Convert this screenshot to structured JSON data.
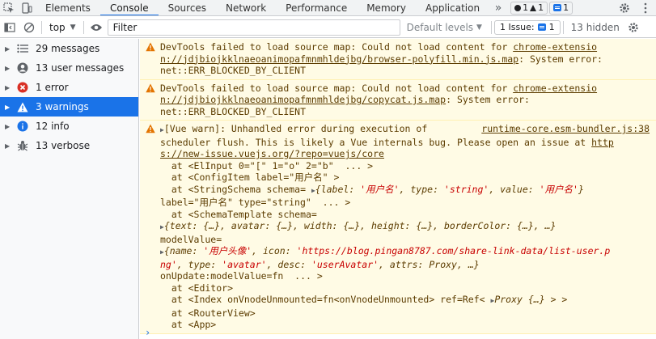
{
  "tabs": {
    "items": [
      "Elements",
      "Console",
      "Sources",
      "Network",
      "Performance",
      "Memory",
      "Application"
    ],
    "more": "»",
    "errors_count": "1",
    "warnings_count": "1",
    "messages_count": "1"
  },
  "toolbar": {
    "context": "top",
    "filter_placeholder": "Filter",
    "levels": "Default levels",
    "issues": "1 Issue:",
    "issues_count": "1",
    "hidden": "13 hidden"
  },
  "sidebar": {
    "items": [
      {
        "label": "29 messages",
        "icon": "list-icon"
      },
      {
        "label": "13 user messages",
        "icon": "user-icon"
      },
      {
        "label": "1 error",
        "icon": "error-icon"
      },
      {
        "label": "3 warnings",
        "icon": "warning-icon"
      },
      {
        "label": "12 info",
        "icon": "info-icon"
      },
      {
        "label": "13 verbose",
        "icon": "bug-icon"
      }
    ],
    "selected_index": 3
  },
  "console": {
    "warn1": {
      "l1_text": "DevTools failed to load source map: Could not load content for ",
      "l1_link": "chrome-extensio",
      "l2_link": "n://jdjbiojkklnaeoanimopafmnmhldejbg/browser-polyfill.min.js.map",
      "l2_text": ": System error:",
      "l3_text": "net::ERR_BLOCKED_BY_CLIENT"
    },
    "warn2": {
      "l1_text": "DevTools failed to load source map: Could not load content for ",
      "l1_link": "chrome-extensio",
      "l2_link": "n://jdjbiojkklnaeoanimopafmnmhldejbg/copycat.js.map",
      "l2_text": ": System error:",
      "l3_text": "net::ERR_BLOCKED_BY_CLIENT"
    },
    "warn3": {
      "source": "runtime-core.esm-bundler.js:38",
      "l1": "[Vue warn]: Unhandled error during execution of",
      "l2a": "scheduler flush. This is likely a Vue internals bug. Please open an issue at ",
      "l2_link": "http",
      "l3_link": "s://new-issue.vuejs.org/?repo=vuejs/core",
      "s1": "  at <ElInput 0=\"[\" 1=\"o\" 2=\"b\"  ... >",
      "s2": "  at <ConfigItem label=\"用户名\" >",
      "s3a": "  at <StringSchema schema= ",
      "s3_obj": {
        "open": "{",
        "k1": "label: ",
        "v1": "'用户名'",
        "k2": ", type: ",
        "v2": "'string'",
        "k3": ", value: ",
        "v3": "'用户名'",
        "close": "}"
      },
      "s4": "label=\"用户名\" type=\"string\"  ... >",
      "s5": "  at <SchemaTemplate schema=",
      "s6": "{text: {…}, avatar: {…}, width: {…}, height: {…}, borderColor: {…}, …}",
      "s7": "modelValue=",
      "s8_obj": {
        "k1": "{name: ",
        "v1": "'用户头像'",
        "k2": ", icon: ",
        "v2": "'https://blog.pingan8787.com/share-link-data/list-user.p"
      },
      "s9_obj": {
        "v2b": "ng'",
        "k3": ", type: ",
        "v3": "'avatar'",
        "k4": ", desc: ",
        "v4": "'userAvatar'",
        "k5": ", attrs: ",
        "v5": "Proxy",
        "end": ", …}"
      },
      "s10": "onUpdate:modelValue=fn  ... >",
      "s11": "  at <Editor>",
      "s12a": "  at <Index onVnodeUnmounted=fn<onVnodeUnmounted> ref=Ref< ",
      "s12_proxy": "Proxy {…}",
      "s12b": " > >",
      "s13": "  at <RouterView>",
      "s14": "  at <App>"
    },
    "prompt": "›"
  }
}
